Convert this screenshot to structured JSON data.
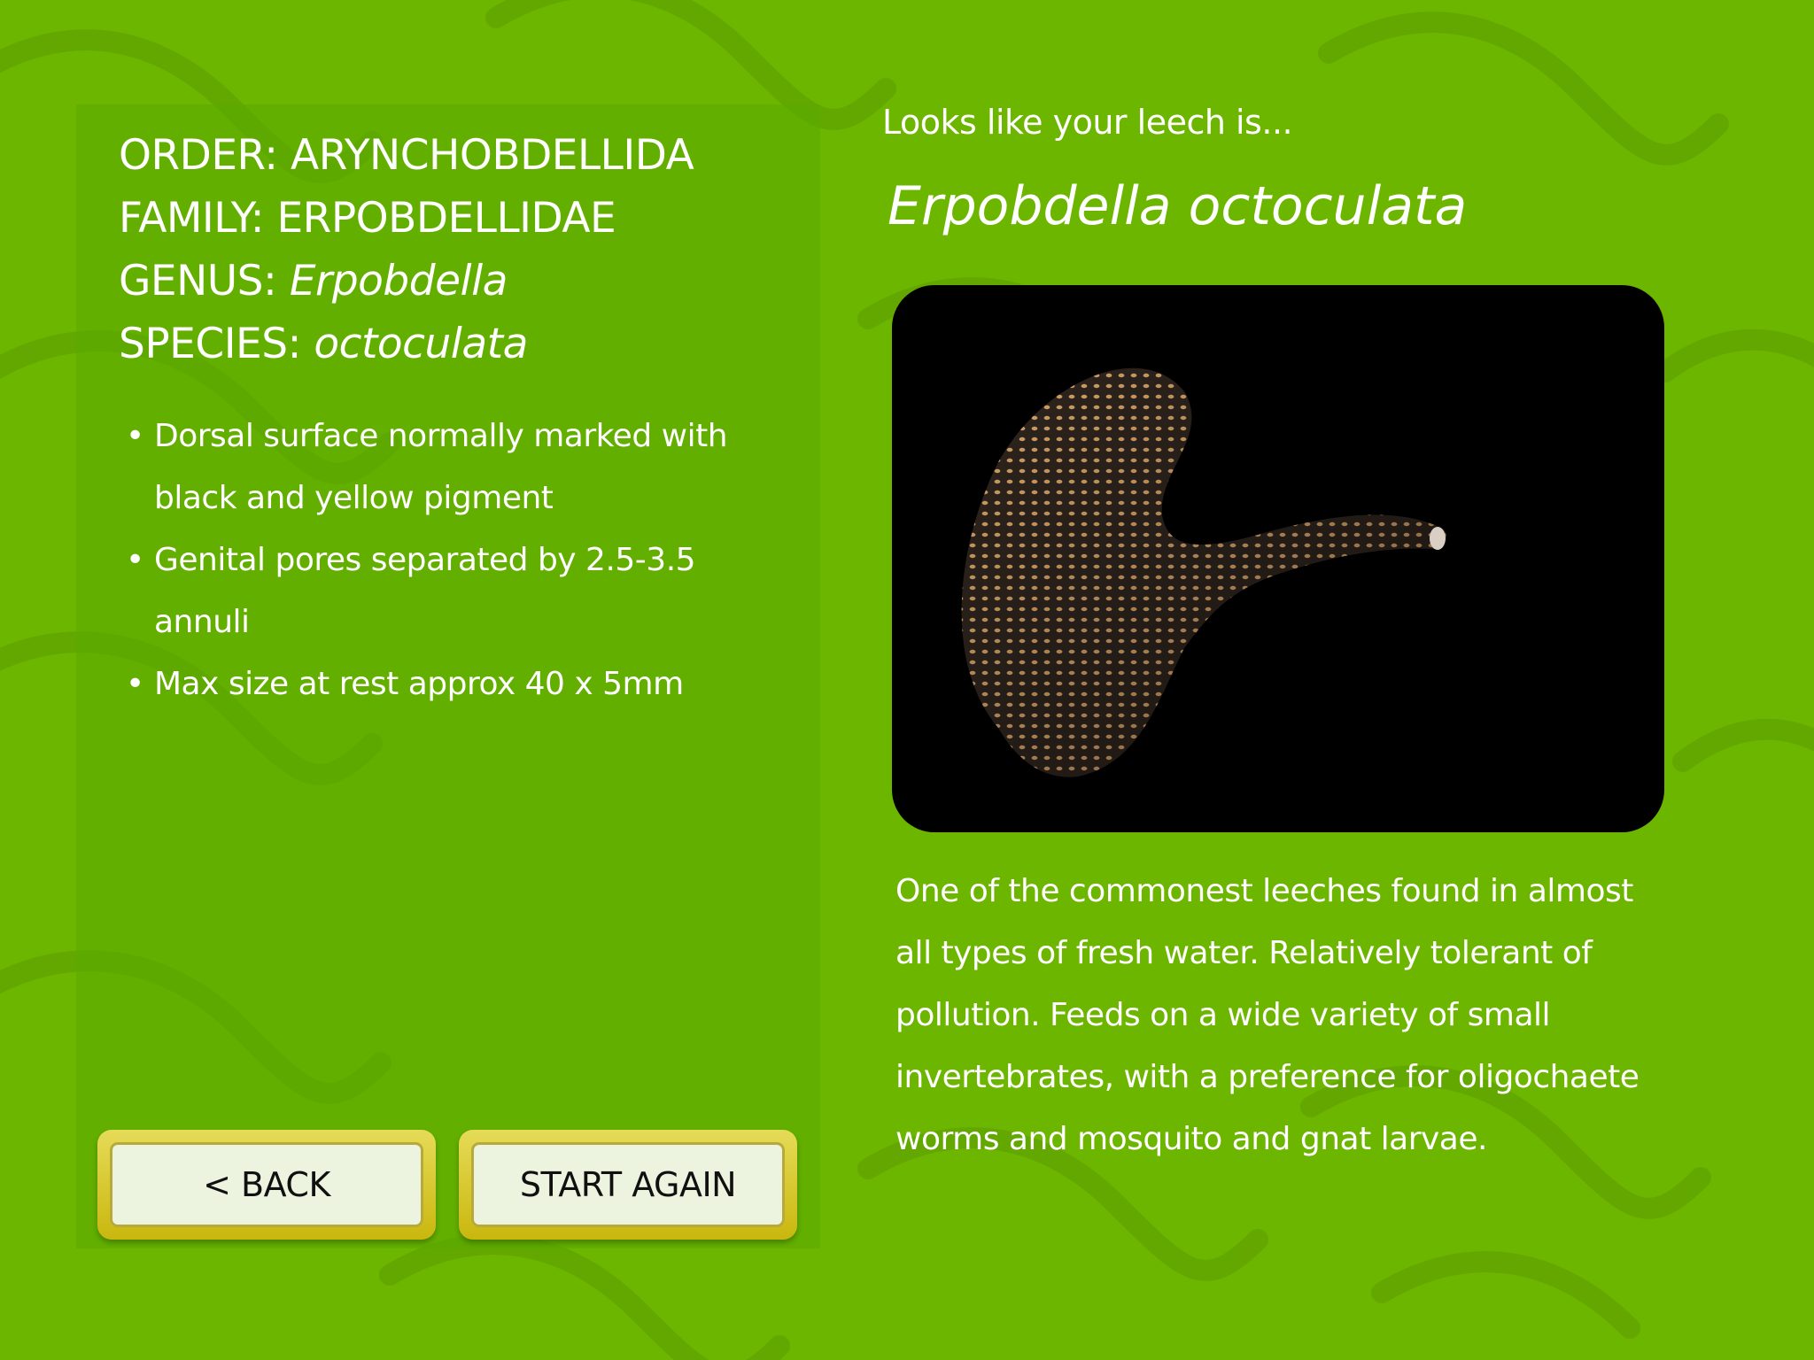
{
  "taxonomy": {
    "order_label": "ORDER:",
    "order_value": "ARYNCHOBDELLIDA",
    "family_label": "FAMILY:",
    "family_value": "ERPOBDELLIDAE",
    "genus_label": "GENUS:",
    "genus_value": "Erpobdella",
    "species_label": "SPECIES:",
    "species_value": "octoculata"
  },
  "facts": [
    "Dorsal surface normally marked with black and yellow pigment",
    "Genital pores separated by 2.5-3.5 annuli",
    "Max size at rest approx 40 x 5mm"
  ],
  "buttons": {
    "back_label": "< BACK",
    "start_again_label": "START AGAIN"
  },
  "result": {
    "intro": "Looks like your leech is...",
    "species_name": "Erpobdella octoculata",
    "description": "One of the commonest leeches found in almost all types of fresh water. Relatively tolerant of pollution. Feeds on a wide variety of small invertebrates, with a preference for oligochaete worms and mosquito and gnat larvae."
  },
  "colors": {
    "background": "#6db600",
    "button_frame": "#d4c42a",
    "button_face": "#ecf4e0",
    "text": "#ffffff"
  }
}
